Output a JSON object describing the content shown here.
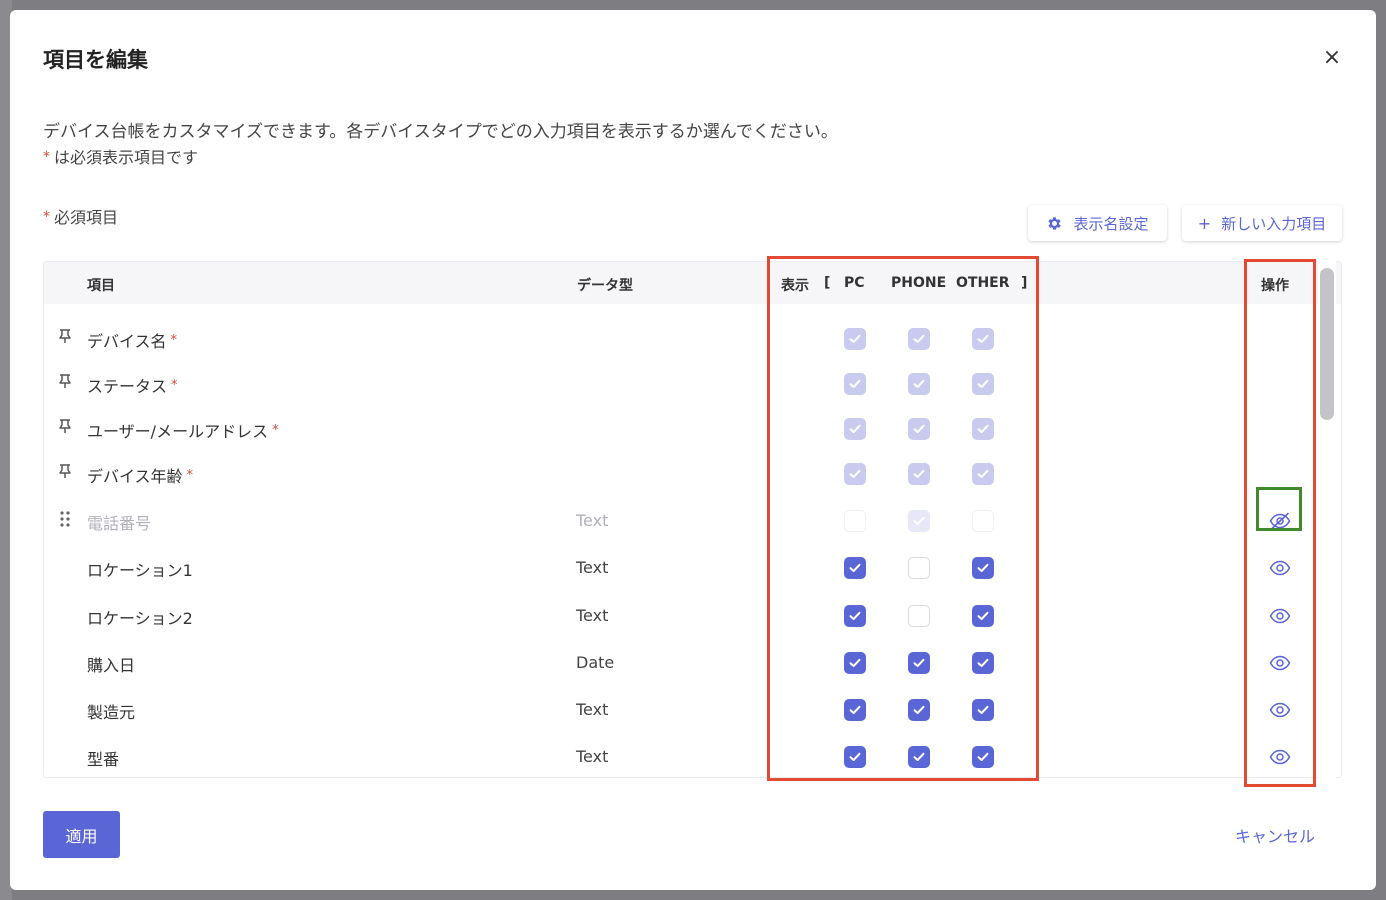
{
  "modal": {
    "title": "項目を編集",
    "close_symbol": "×",
    "description": "デバイス台帳をカスタマイズできます。各デバイスタイプでどの入力項目を表示するか選んでください。",
    "note_star": "*",
    "note_text": "は必須表示項目です",
    "section_star": "*",
    "section_label": "必須項目"
  },
  "toolbar": {
    "display_name_label": "表示名設定",
    "display_name_icon": "gear-icon",
    "new_item_plus": "+",
    "new_item_label": "新しい入力項目"
  },
  "table": {
    "headers": {
      "item": "項目",
      "type": "データ型",
      "display": "表示",
      "bracket_open": "[",
      "pc": "PC",
      "phone": "PHONE",
      "other": "OTHER",
      "bracket_close": "]",
      "ops": "操作"
    },
    "rows": [
      {
        "handle": "pin-icon",
        "label": "デバイス名",
        "required_mark": "*",
        "type": "",
        "pc": "locked",
        "phone": "locked",
        "other": "locked",
        "eye": ""
      },
      {
        "handle": "pin-icon",
        "label": "ステータス",
        "required_mark": "*",
        "type": "",
        "pc": "locked",
        "phone": "locked",
        "other": "locked",
        "eye": ""
      },
      {
        "handle": "pin-icon",
        "label": "ユーザー/メールアドレス",
        "required_mark": "*",
        "type": "",
        "pc": "locked",
        "phone": "locked",
        "other": "locked",
        "eye": ""
      },
      {
        "handle": "pin-icon",
        "label": "デバイス年齢",
        "required_mark": "*",
        "type": "",
        "pc": "locked",
        "phone": "locked",
        "other": "locked",
        "eye": ""
      },
      {
        "handle": "drag-handle-icon",
        "label": "電話番号",
        "required_mark": "",
        "type": "Text",
        "pc": "ghost",
        "phone": "faint",
        "other": "ghost",
        "eye": "eye-hidden-icon",
        "disabled": true
      },
      {
        "handle": "",
        "label": "ロケーション1",
        "required_mark": "",
        "type": "Text",
        "pc": "on",
        "phone": "off",
        "other": "on",
        "eye": "eye-icon"
      },
      {
        "handle": "",
        "label": "ロケーション2",
        "required_mark": "",
        "type": "Text",
        "pc": "on",
        "phone": "off",
        "other": "on",
        "eye": "eye-icon"
      },
      {
        "handle": "",
        "label": "購入日",
        "required_mark": "",
        "type": "Date",
        "pc": "on",
        "phone": "on",
        "other": "on",
        "eye": "eye-icon"
      },
      {
        "handle": "",
        "label": "製造元",
        "required_mark": "",
        "type": "Text",
        "pc": "on",
        "phone": "on",
        "other": "on",
        "eye": "eye-icon"
      },
      {
        "handle": "",
        "label": "型番",
        "required_mark": "",
        "type": "Text",
        "pc": "on",
        "phone": "on",
        "other": "on",
        "eye": "eye-icon"
      }
    ]
  },
  "footer": {
    "apply_label": "適用",
    "cancel_label": "キャンセル"
  },
  "colors": {
    "accent": "#5b66d6",
    "required": "#e0473a",
    "highlight_red": "#e24a33",
    "highlight_green": "#3f8a2c"
  }
}
